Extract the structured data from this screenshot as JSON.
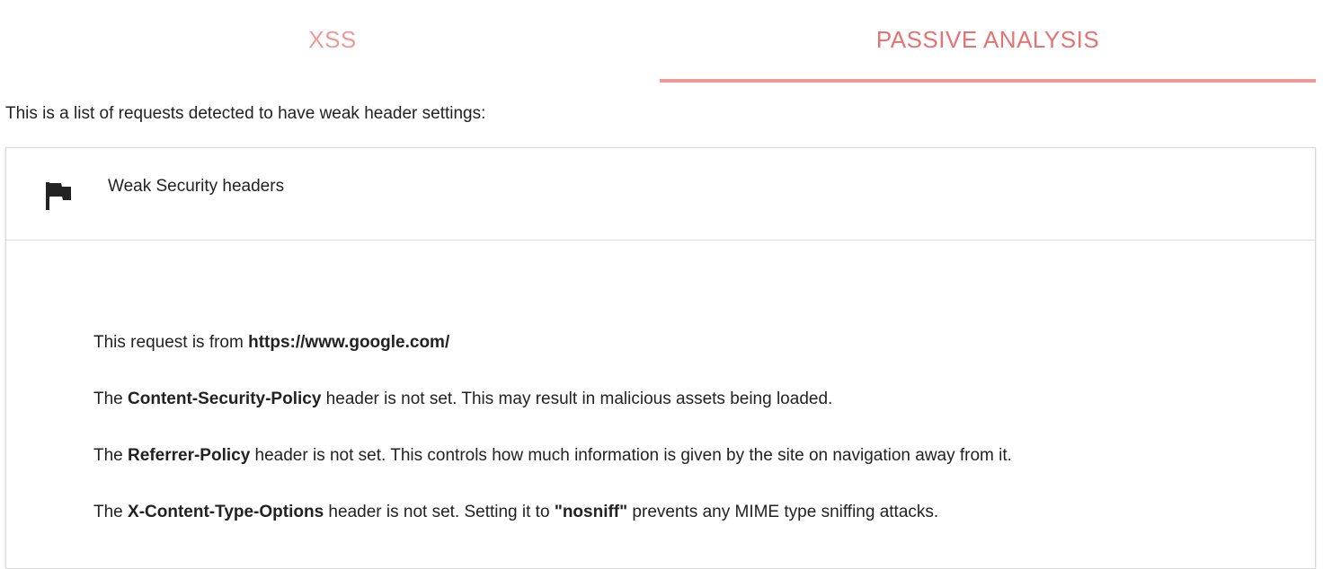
{
  "tabs": [
    {
      "label": "XSS",
      "active": false
    },
    {
      "label": "PASSIVE ANALYSIS",
      "active": true
    }
  ],
  "intro": "This is a list of requests detected to have weak header settings:",
  "panel": {
    "icon": "flag-icon",
    "title": "Weak Security headers",
    "request": {
      "prefix": "This request is from ",
      "url": "https://www.google.com/"
    },
    "findings": [
      {
        "prefix": "The ",
        "header": "Content-Security-Policy",
        "text": " header is not set. This may result in malicious assets being loaded."
      },
      {
        "prefix": "The ",
        "header": "Referrer-Policy",
        "text": " header is not set. This controls how much information is given by the site on navigation away from it."
      },
      {
        "prefix": "The ",
        "header": "X-Content-Type-Options",
        "text_before": " header is not set. Setting it to ",
        "value": "\"nosniff\"",
        "text_after": " prevents any MIME type sniffing attacks."
      }
    ]
  },
  "colors": {
    "tab_inactive": "#ef9a9a",
    "tab_active": "#e57373",
    "indicator": "#ef9a9a"
  }
}
